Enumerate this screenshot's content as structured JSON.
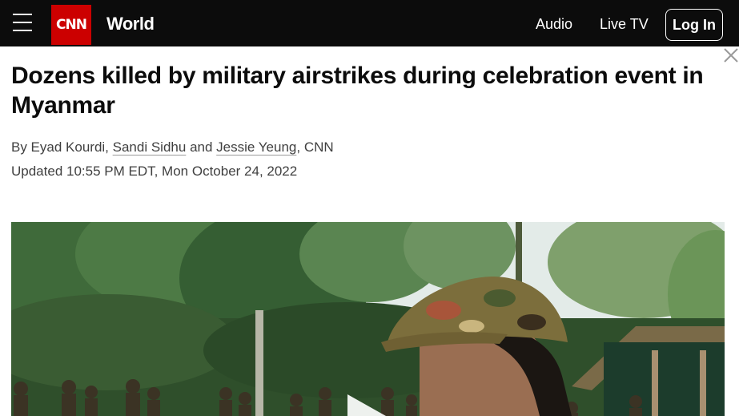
{
  "header": {
    "logo_text": "CNN",
    "section": "World",
    "nav": [
      "Audio",
      "Live TV"
    ],
    "login_label": "Log In"
  },
  "article": {
    "headline": "Dozens killed by military airstrikes during celebration event in Myanmar",
    "byline": {
      "prefix": "By Eyad Kourdi,",
      "author1": "Sandi Sidhu",
      "and": "and",
      "author2": "Jessie Yeung",
      "suffix": ", CNN"
    },
    "updated": "Updated 10:55 PM EDT, Mon October 24, 2022"
  },
  "colors": {
    "topbar_bg": "#0c0c0c",
    "brand_red": "#cc0000",
    "text_dark": "#0c0c0c",
    "text_meta": "#404040"
  },
  "icons": [
    "menu-icon",
    "close-icon",
    "play-icon"
  ]
}
